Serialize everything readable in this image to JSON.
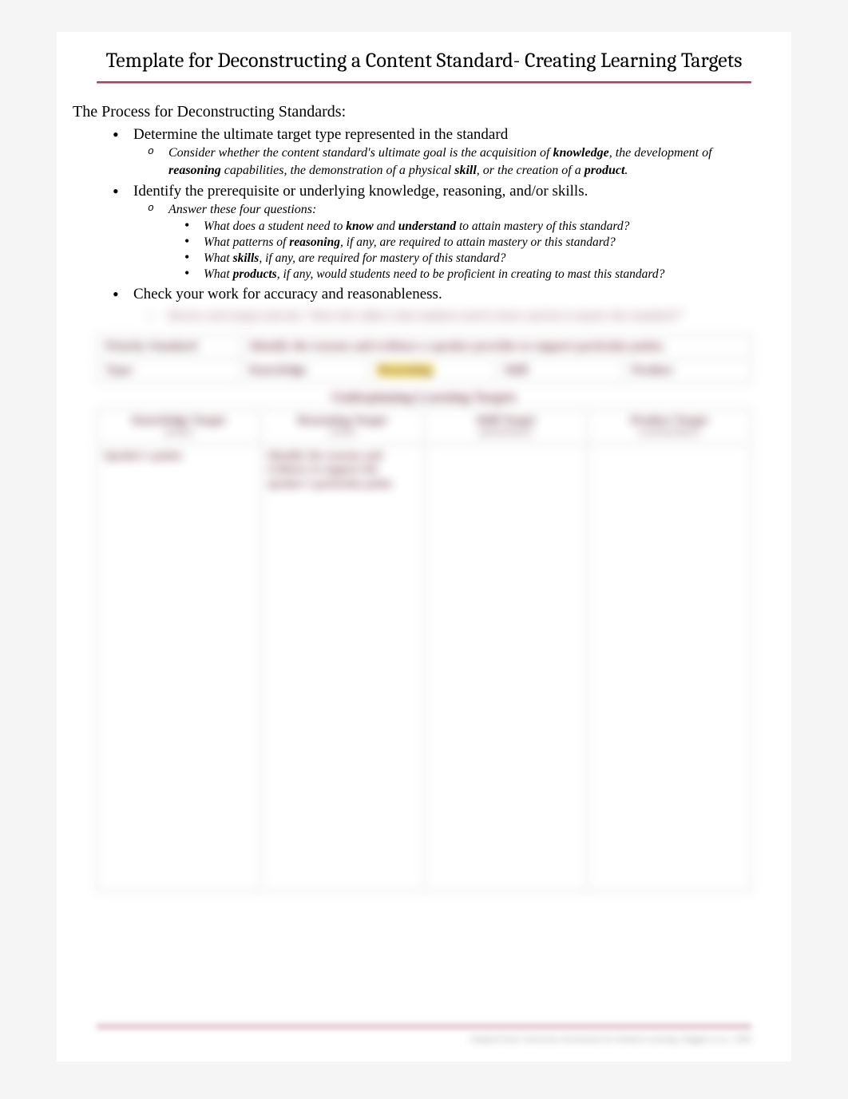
{
  "title": "Template for Deconstructing a Content Standard- Creating Learning Targets",
  "process_heading": "The Process for Deconstructing Standards:",
  "bullets": {
    "b1": "Determine the ultimate target type represented in the standard",
    "b1_sub_pre": "Consider whether the content standard's ultimate goal is the acquisition of ",
    "b1_sub_k": "knowledge",
    "b1_sub_mid1": ", the development of ",
    "b1_sub_r": "reasoning",
    "b1_sub_mid2": " capabilities, the demonstration of a physical ",
    "b1_sub_s": "skill",
    "b1_sub_mid3": ", or the creation of a ",
    "b1_sub_p": "product",
    "b1_sub_end": ".",
    "b2": "Identify the prerequisite or underlying knowledge, reasoning, and/or skills.",
    "b2_sub": "Answer these four questions:",
    "q1_a": "What does a student need to ",
    "q1_b": "know",
    "q1_c": " and ",
    "q1_d": "understand",
    "q1_e": " to attain mastery of this standard?",
    "q2_a": "What patterns of ",
    "q2_b": "reasoning",
    "q2_c": ", if any, are required to attain mastery or this standard?",
    "q3_a": "What ",
    "q3_b": "skills",
    "q3_c": ", if any, are required for mastery of this standard?",
    "q4_a": "What ",
    "q4_b": "products",
    "q4_c": ", if any, would students need to be proficient in creating to mast this standard?",
    "b3": "Check your work for accuracy and reasonableness.",
    "b3_sub": "Review each target and ask, \"Does this reflect what students need to know and do to master this standard?\""
  },
  "table1": {
    "row1_label": "Priority Standard",
    "row1_text": "Identify the reasons and evidence a speaker provides to support particular points.",
    "row2_label": "Type:",
    "type1": "Knowledge",
    "type2": "Reasoning",
    "type3": "Skill",
    "type4": "Product"
  },
  "section_header": "Underpinning Learning Targets",
  "table2": {
    "h1": "Knowledge Target",
    "h1_sub": "(nouns)",
    "h2": "Reasoning Target",
    "h2_sub": "(verbs)",
    "h3": "Skill Target",
    "h3_sub": "(performance)",
    "h4": "Product Target",
    "h4_sub": "(create/produce)",
    "cell1": "Speaker's points",
    "cell2": "Identify the reasons and evidence to support the speaker's particular point."
  },
  "footer": "Adapted from Classroom Assessment for Student Learning, Stiggins et al., 2006"
}
